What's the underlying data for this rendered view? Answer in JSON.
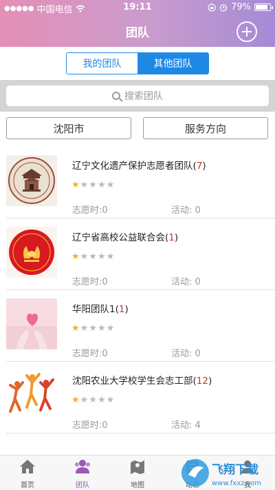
{
  "status_bar": {
    "carrier": "中国电信",
    "time": "19:11",
    "battery": "79%",
    "battery_level": 0.79
  },
  "header": {
    "title": "团队"
  },
  "segment": {
    "tabs": [
      {
        "label": "我的团队",
        "active": false
      },
      {
        "label": "其他团队",
        "active": true
      }
    ]
  },
  "search": {
    "placeholder": "搜索团队"
  },
  "filters": {
    "city": "沈阳市",
    "direction": "服务方向"
  },
  "teams": [
    {
      "name": "辽宁文化遗产保护志愿者团队",
      "count": "7",
      "rating": 1,
      "hours_label": "志愿时:",
      "hours": "0",
      "activity_label": "活动:",
      "activity": "0",
      "avatar": "seal-logo"
    },
    {
      "name": "辽宁省高校公益联合会",
      "count": "1",
      "rating": 1,
      "hours_label": "志愿时:",
      "hours": "0",
      "activity_label": "活动:",
      "activity": "0",
      "avatar": "red-hands-logo"
    },
    {
      "name": "华阳团队1",
      "count": "1",
      "rating": 1,
      "hours_label": "志愿时:",
      "hours": "0",
      "activity_label": "活动:",
      "activity": "0",
      "avatar": "pink-heart-photo"
    },
    {
      "name": "沈阳农业大学校学生会志工部",
      "count": "12",
      "rating": 1,
      "hours_label": "志愿时:",
      "hours": "0",
      "activity_label": "活动:",
      "activity": "4",
      "avatar": "jumping-people-art"
    }
  ],
  "tabbar": {
    "items": [
      {
        "label": "首页",
        "icon": "home-icon"
      },
      {
        "label": "团队",
        "icon": "team-icon",
        "active": true
      },
      {
        "label": "地图",
        "icon": "map-icon"
      },
      {
        "label": "动态",
        "icon": "feed-icon"
      },
      {
        "label": "我",
        "icon": "user-icon"
      }
    ]
  },
  "watermark": {
    "brand": "飞翔下载",
    "url": "www.fxxz.com"
  },
  "colors": {
    "accent": "#1e88e5",
    "header_start": "#e58fb6",
    "header_end": "#a58ad6",
    "count": "#c0392b",
    "star": "#f2b01e",
    "active_tab": "#9b59b6"
  }
}
